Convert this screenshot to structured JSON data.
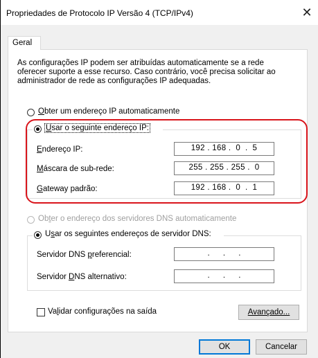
{
  "window": {
    "title": "Propriedades de Protocolo IP Versão 4 (TCP/IPv4)",
    "close_glyph": "✕"
  },
  "tabs": [
    {
      "label": "Geral",
      "selected": true
    }
  ],
  "info_text": "As configurações IP podem ser atribuídas automaticamente se a rede oferecer suporte a esse recurso. Caso contrário, você precisa solicitar ao administrador de rede as configurações IP adequadas.",
  "ip_section": {
    "auto_option": {
      "label": "Obter um endereço IP automaticamente",
      "selected": false
    },
    "manual_option": {
      "label": "Usar o seguinte endereço IP:",
      "selected": true
    },
    "fields": [
      {
        "label": "Endereço IP:",
        "value": "192 . 168 .  0  .  5"
      },
      {
        "label": "Máscara de sub-rede:",
        "value": "255 . 255 . 255 .  0"
      },
      {
        "label": "Gateway padrão:",
        "value": "192 . 168 .  0  .  1"
      }
    ]
  },
  "dns_section": {
    "auto_option": {
      "label": "Obter o endereço dos servidores DNS automaticamente",
      "selected": false,
      "disabled": true
    },
    "manual_option": {
      "label": "Usar os seguintes endereços de servidor DNS:",
      "selected": true
    },
    "fields": [
      {
        "label": "Servidor DNS preferencial:",
        "value": ".      .      ."
      },
      {
        "label": "Servidor DNS alternativo:",
        "value": ".      .      ."
      }
    ]
  },
  "validate_checkbox": {
    "label": "Validar configurações na saída",
    "checked": false
  },
  "buttons": {
    "advanced": "Avançado...",
    "ok": "OK",
    "cancel": "Cancelar"
  },
  "colors": {
    "highlight": "#d9141b",
    "panel_bg": "#ffffff",
    "dialog_bg": "#f0f0f0",
    "accent": "#0078d7"
  }
}
